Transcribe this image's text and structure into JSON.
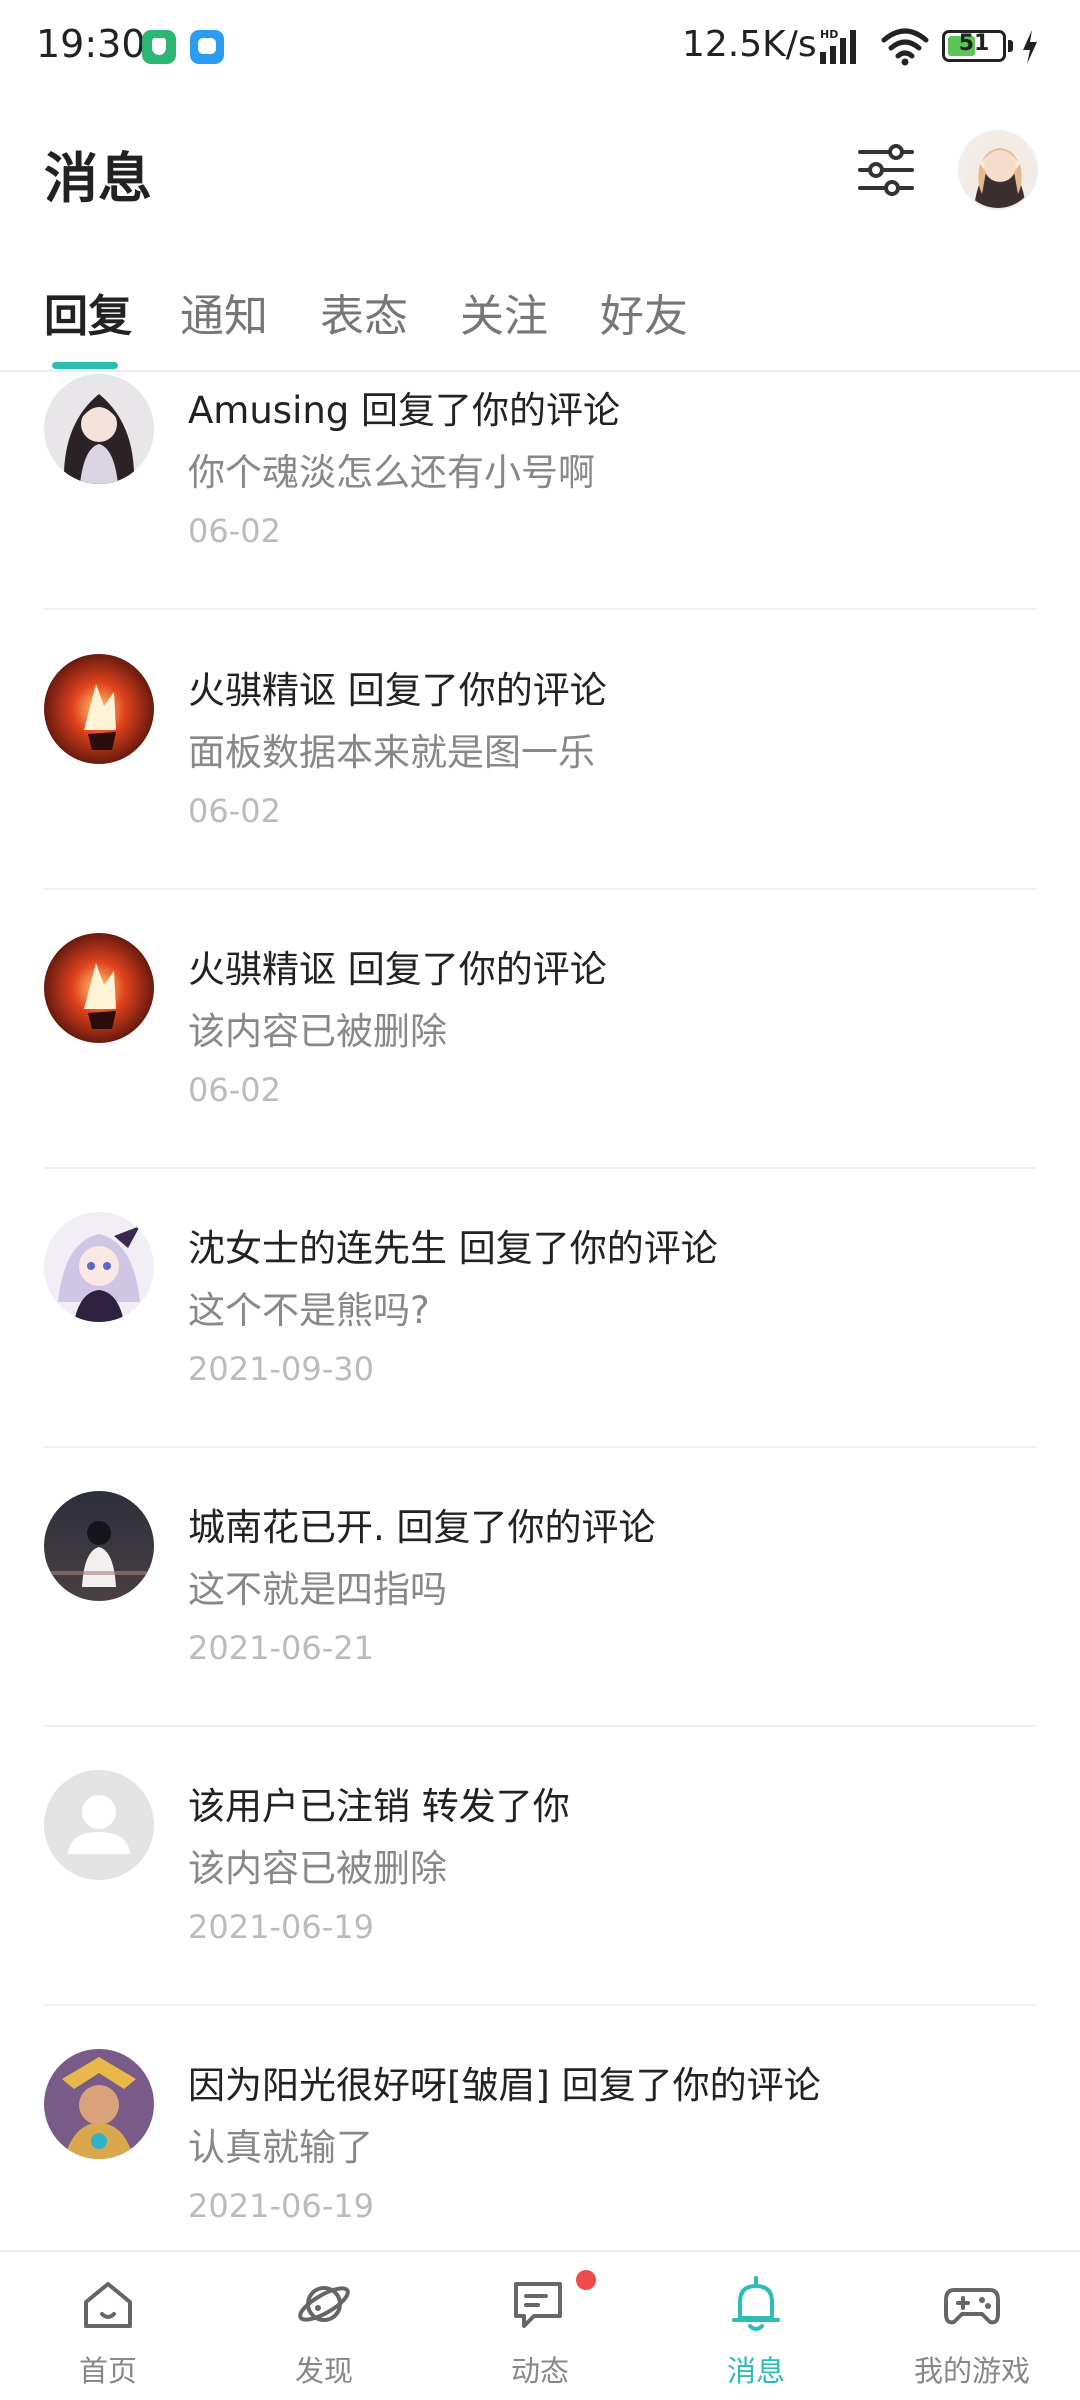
{
  "status_bar": {
    "time": "19:30",
    "network_speed": "12.5K/s",
    "signal_label": "HD",
    "battery": "51",
    "battery_level": 0.51
  },
  "header": {
    "title": "消息",
    "filter_icon": "sliders-icon",
    "avatar_icon": "user-avatar"
  },
  "tabs": [
    {
      "label": "回复",
      "active": true
    },
    {
      "label": "通知",
      "active": false
    },
    {
      "label": "表态",
      "active": false
    },
    {
      "label": "关注",
      "active": false
    },
    {
      "label": "好友",
      "active": false
    }
  ],
  "messages": [
    {
      "title": "Amusing 回复了你的评论",
      "content": "你个魂淡怎么还有小号啊",
      "date": "06-02"
    },
    {
      "title": "火骐精讴 回复了你的评论",
      "content": "面板数据本来就是图一乐",
      "date": "06-02"
    },
    {
      "title": "火骐精讴 回复了你的评论",
      "content": "该内容已被删除",
      "date": "06-02"
    },
    {
      "title": "沈女士的连先生 回复了你的评论",
      "content": "这个不是熊吗?",
      "date": "2021-09-30"
    },
    {
      "title": "城南花已开. 回复了你的评论",
      "content": "这不就是四指吗",
      "date": "2021-06-21"
    },
    {
      "title": "该用户已注销 转发了你",
      "content": "该内容已被删除",
      "date": "2021-06-19"
    },
    {
      "title": "因为阳光很好呀[皱眉] 回复了你的评论",
      "content": "认真就输了",
      "date": "2021-06-19"
    }
  ],
  "bottom_nav": [
    {
      "label": "首页",
      "icon": "home-icon",
      "active": false
    },
    {
      "label": "发现",
      "icon": "planet-icon",
      "active": false
    },
    {
      "label": "动态",
      "icon": "chat-icon",
      "active": false,
      "badge": true
    },
    {
      "label": "消息",
      "icon": "bell-icon",
      "active": true
    },
    {
      "label": "我的游戏",
      "icon": "gamepad-icon",
      "active": false
    }
  ],
  "colors": {
    "accent": "#2ebdb4",
    "badge": "#f04a4a"
  }
}
